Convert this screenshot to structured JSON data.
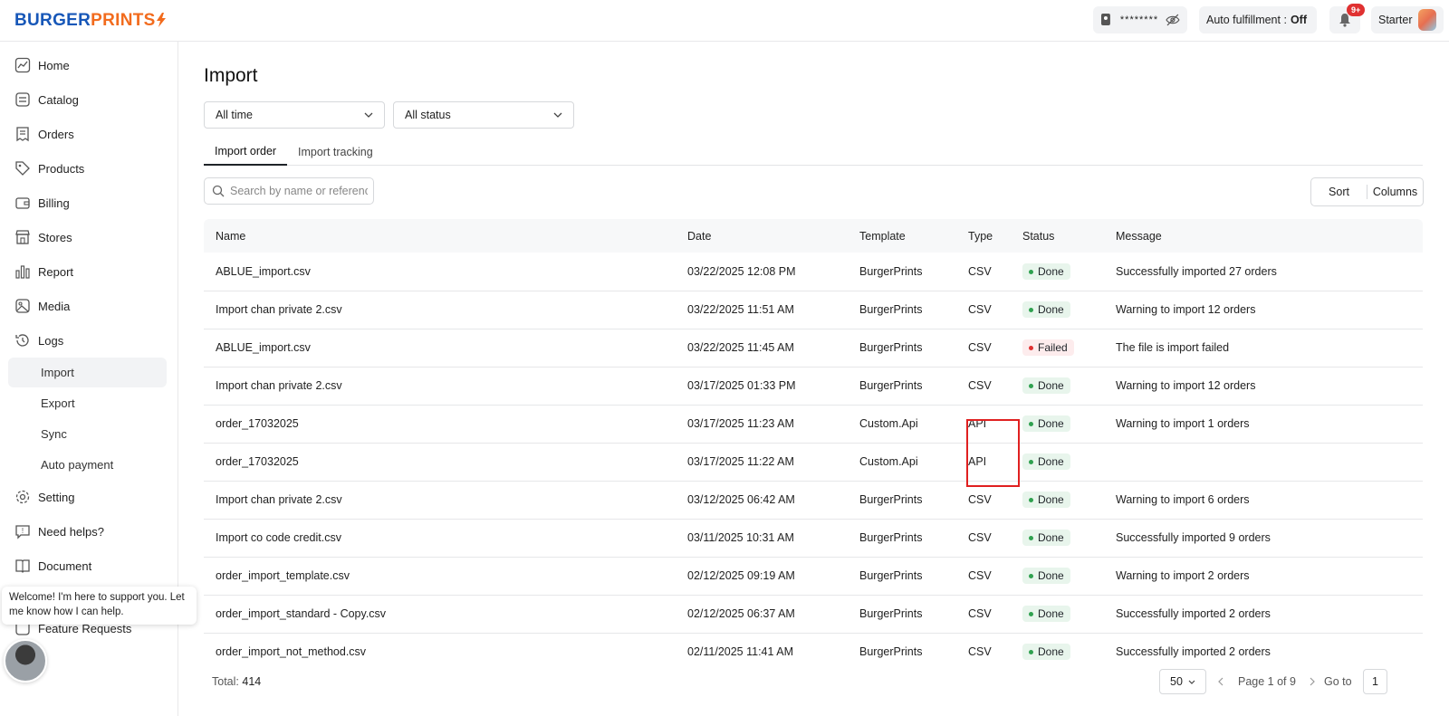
{
  "brand": {
    "part1": "BURGER",
    "part2": "PRINTS"
  },
  "header": {
    "password_mask": "********",
    "auto_fulfillment_label": "Auto fulfillment :",
    "auto_fulfillment_value": "Off",
    "notification_badge": "9+",
    "plan": "Starter"
  },
  "sidebar": {
    "items": [
      {
        "label": "Home",
        "icon": "home-chart-icon"
      },
      {
        "label": "Catalog",
        "icon": "catalog-icon"
      },
      {
        "label": "Orders",
        "icon": "orders-icon"
      },
      {
        "label": "Products",
        "icon": "tag-icon"
      },
      {
        "label": "Billing",
        "icon": "wallet-icon"
      },
      {
        "label": "Stores",
        "icon": "store-icon"
      },
      {
        "label": "Report",
        "icon": "bar-chart-icon"
      },
      {
        "label": "Media",
        "icon": "image-icon"
      },
      {
        "label": "Logs",
        "icon": "history-icon"
      }
    ],
    "log_subitems": [
      "Import",
      "Export",
      "Sync",
      "Auto payment"
    ],
    "bottom_items": [
      {
        "label": "Setting",
        "icon": "gear-icon"
      },
      {
        "label": "Need helps?",
        "icon": "help-chat-icon"
      },
      {
        "label": "Document",
        "icon": "book-icon"
      },
      {
        "label": "Feature Requests",
        "icon": "feature-icon"
      }
    ],
    "chat_message": "Welcome! I'm here to support you. Let me know how I can help."
  },
  "page": {
    "title": "Import",
    "filter_time": "All time",
    "filter_status": "All status",
    "tabs": [
      "Import order",
      "Import tracking"
    ],
    "search_placeholder": "Search by name or reference",
    "sort_label": "Sort",
    "columns_label": "Columns"
  },
  "table": {
    "headers": {
      "name": "Name",
      "date": "Date",
      "template": "Template",
      "type": "Type",
      "status": "Status",
      "message": "Message"
    },
    "rows": [
      {
        "name": "ABLUE_import.csv",
        "date": "03/22/2025 12:08 PM",
        "template": "BurgerPrints",
        "type": "CSV",
        "status": "Done",
        "message": "Successfully imported 27 orders"
      },
      {
        "name": "Import chan private 2.csv",
        "date": "03/22/2025 11:51 AM",
        "template": "BurgerPrints",
        "type": "CSV",
        "status": "Done",
        "message": "Warning to import 12 orders"
      },
      {
        "name": "ABLUE_import.csv",
        "date": "03/22/2025 11:45 AM",
        "template": "BurgerPrints",
        "type": "CSV",
        "status": "Failed",
        "message": "The file is import failed"
      },
      {
        "name": "Import chan private 2.csv",
        "date": "03/17/2025 01:33 PM",
        "template": "BurgerPrints",
        "type": "CSV",
        "status": "Done",
        "message": "Warning to import 12 orders"
      },
      {
        "name": "order_17032025",
        "date": "03/17/2025 11:23 AM",
        "template": "Custom.Api",
        "type": "API",
        "status": "Done",
        "message": "Warning to import 1 orders"
      },
      {
        "name": "order_17032025",
        "date": "03/17/2025 11:22 AM",
        "template": "Custom.Api",
        "type": "API",
        "status": "Done",
        "message": ""
      },
      {
        "name": "Import chan private 2.csv",
        "date": "03/12/2025 06:42 AM",
        "template": "BurgerPrints",
        "type": "CSV",
        "status": "Done",
        "message": "Warning to import 6 orders"
      },
      {
        "name": "Import co code credit.csv",
        "date": "03/11/2025 10:31 AM",
        "template": "BurgerPrints",
        "type": "CSV",
        "status": "Done",
        "message": "Successfully imported 9 orders"
      },
      {
        "name": "order_import_template.csv",
        "date": "02/12/2025 09:19 AM",
        "template": "BurgerPrints",
        "type": "CSV",
        "status": "Done",
        "message": "Warning to import 2 orders"
      },
      {
        "name": "order_import_standard - Copy.csv",
        "date": "02/12/2025 06:37 AM",
        "template": "BurgerPrints",
        "type": "CSV",
        "status": "Done",
        "message": "Successfully imported 2 orders"
      },
      {
        "name": "order_import_not_method.csv",
        "date": "02/11/2025 11:41 AM",
        "template": "BurgerPrints",
        "type": "CSV",
        "status": "Done",
        "message": "Successfully imported 2 orders"
      }
    ]
  },
  "footer": {
    "total_label": "Total:",
    "total_value": "414",
    "per_page": "50",
    "page_info": "Page 1 of 9",
    "goto_label": "Go to",
    "goto_value": "1"
  },
  "colors": {
    "brand_blue": "#1757b8",
    "brand_orange": "#f26b1d",
    "done_green": "#2fa14f",
    "failed_red": "#e03131",
    "highlight_red": "#e02020"
  }
}
